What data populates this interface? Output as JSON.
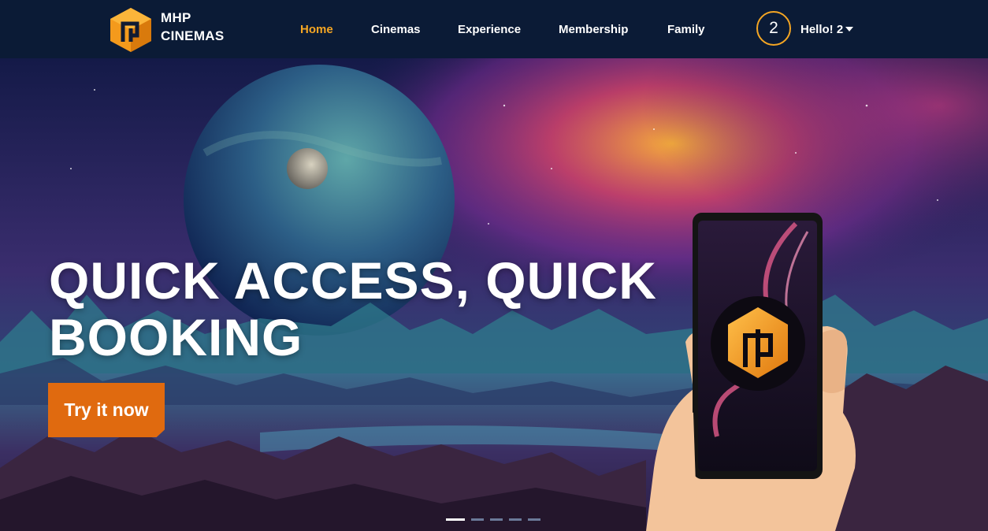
{
  "brand": {
    "line1": "MHP",
    "line2": "CINEMAS"
  },
  "nav": {
    "items": [
      {
        "label": "Home",
        "active": true
      },
      {
        "label": "Cinemas",
        "active": false
      },
      {
        "label": "Experience",
        "active": false
      },
      {
        "label": "Membership",
        "active": false
      },
      {
        "label": "Family",
        "active": false
      }
    ]
  },
  "user": {
    "avatar_text": "2",
    "greeting": "Hello! 2"
  },
  "hero": {
    "title": "QUICK ACCESS, QUICK BOOKING",
    "cta_label": "Try it now",
    "slides_total": 5,
    "active_slide": 1
  },
  "colors": {
    "accent": "#f5a623",
    "nav_bg": "#0b1b36",
    "cta": "#e06a0f"
  }
}
